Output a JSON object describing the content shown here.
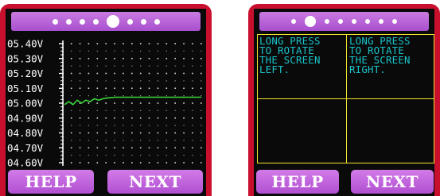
{
  "left_screen": {
    "pager": {
      "count": 8,
      "active_index": 4
    },
    "chart_data": {
      "type": "line",
      "y_tick_labels": [
        "05.40V",
        "05.30V",
        "05.20V",
        "05.10V",
        "05.00V",
        "04.90V",
        "04.80V",
        "04.70V",
        "04.60V"
      ],
      "ylim": [
        4.6,
        5.4
      ],
      "xlim": [
        0,
        16
      ],
      "grid": "dotted",
      "series": [
        {
          "color": "#39d639",
          "x": [
            0,
            0.5,
            1,
            1.5,
            2,
            2.5,
            3,
            3.5,
            4,
            4.5,
            5,
            6,
            7,
            8,
            9,
            10,
            11,
            12,
            13,
            14,
            15,
            16
          ],
          "y": [
            4.99,
            5.01,
            4.99,
            5.02,
            5.0,
            5.02,
            5.01,
            5.03,
            5.02,
            5.03,
            5.035,
            5.04,
            5.04,
            5.04,
            5.04,
            5.04,
            5.04,
            5.04,
            5.04,
            5.04,
            5.04,
            5.04
          ]
        }
      ],
      "axis_color": "#ffffff",
      "grid_color": "#dddddd"
    },
    "buttons": {
      "help": "HELP",
      "next": "NEXT"
    }
  },
  "right_screen": {
    "pager": {
      "count": 8,
      "active_index": 1
    },
    "instructions": {
      "left": "LONG PRESS\nTO ROTATE\nTHE SCREEN\nLEFT.",
      "right": "LONG PRESS\nTO ROTATE\nTHE SCREEN\nRIGHT."
    },
    "buttons": {
      "help": "HELP",
      "next": "NEXT"
    }
  },
  "colors": {
    "frame": "#c8102e",
    "button": "#b04fd1",
    "text_cyan": "#19c3c9",
    "grid_yellow": "#f2e52a",
    "trace_green": "#39d639"
  }
}
